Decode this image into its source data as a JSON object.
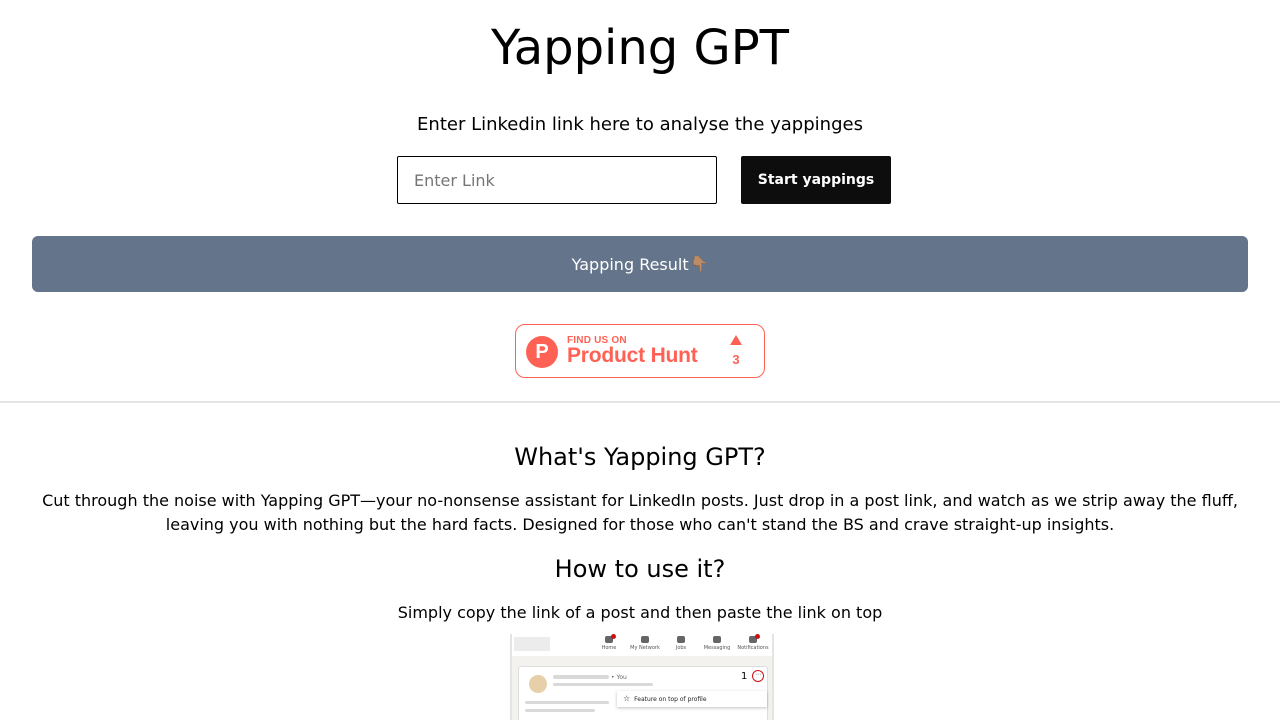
{
  "header": {
    "title": "Yapping GPT",
    "prompt": "Enter Linkedin link here to analyse the yappinges"
  },
  "form": {
    "placeholder": "Enter Link",
    "value": "",
    "submit_label": "Start yappings"
  },
  "result": {
    "label": "Yapping Result",
    "emoji": "👇🏽"
  },
  "product_hunt": {
    "small_text": "FIND US ON",
    "big_text": "Product Hunt",
    "logo_letter": "P",
    "upvotes": "3",
    "color": "#ff6154"
  },
  "about": {
    "title": "What's Yapping GPT?",
    "text": "Cut through the noise with Yapping GPT—your no-nonsense assistant for LinkedIn posts. Just drop in a post link, and watch as we strip away the fluff, leaving you with nothing but the hard facts. Designed for those who can't stand the BS and crave straight-up insights."
  },
  "howto": {
    "title": "How to use it?",
    "text": "Simply copy the link of a post and then paste the link on top"
  },
  "screenshot": {
    "nav": [
      "Home",
      "My Network",
      "Jobs",
      "Messaging",
      "Notifications"
    ],
    "you_label": "• You",
    "step_number": "1",
    "menu_item": "Feature on top of profile"
  },
  "colors": {
    "result_bar": "#64748b",
    "button": "#0d0d0d"
  }
}
